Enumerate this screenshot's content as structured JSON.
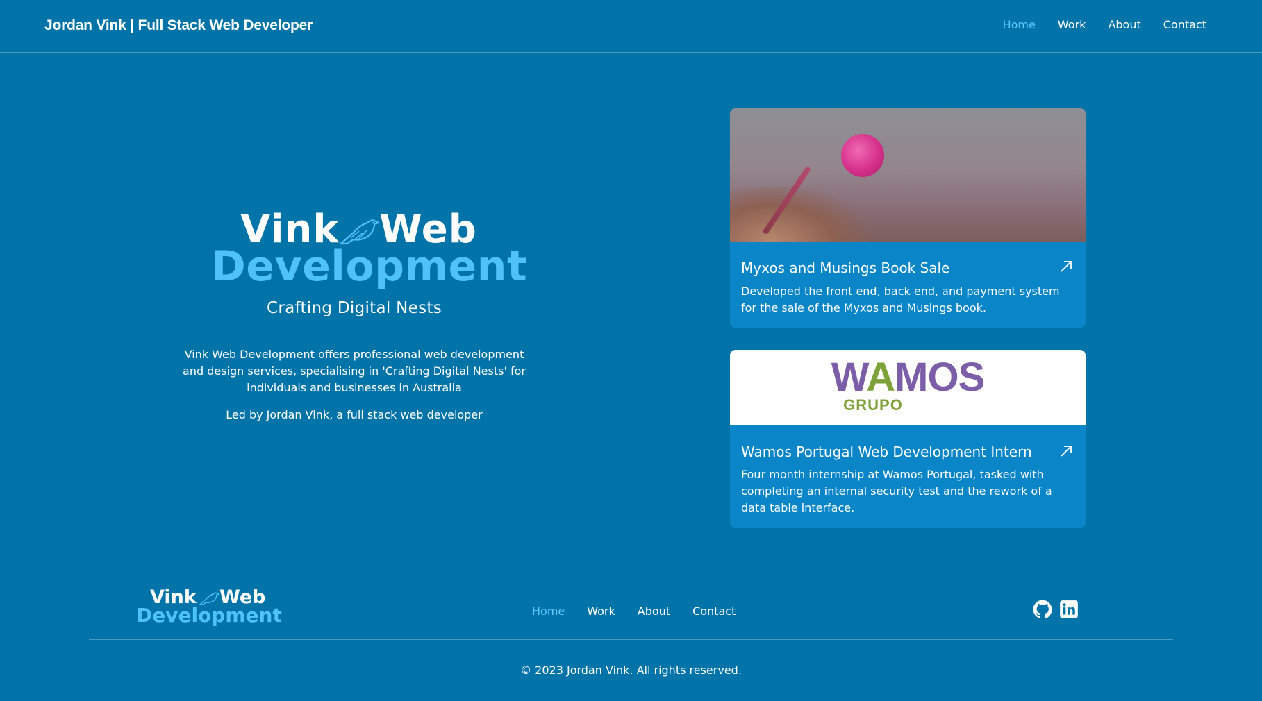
{
  "header": {
    "title": "Jordan Vink | Full Stack Web Developer",
    "nav": [
      {
        "label": "Home",
        "active": true
      },
      {
        "label": "Work",
        "active": false
      },
      {
        "label": "About",
        "active": false
      },
      {
        "label": "Contact",
        "active": false
      }
    ]
  },
  "hero": {
    "logo_word1": "Vink",
    "logo_word2": "Web",
    "logo_word3": "Development",
    "tagline": "Crafting Digital Nests",
    "description": "Vink Web Development offers professional web development and design services, specialising in 'Crafting Digital Nests' for individuals and businesses in Australia",
    "led_by": "Led by Jordan Vink, a full stack web developer"
  },
  "cards": [
    {
      "title": "Myxos and Musings Book Sale",
      "description": "Developed the front end, back end, and payment system for the sale of the Myxos and Musings book.",
      "image": "myxomycete-photo",
      "icon": "external-link-arrow-icon"
    },
    {
      "title": "Wamos Portugal Web Development Intern",
      "description": "Four month internship at Wamos Portugal, tasked with completing an internal security test and the rework of a data table interface.",
      "image": "wamos-grupo-logo",
      "logo_text": "WAMOS",
      "logo_subtext": "GRUPO",
      "icon": "external-link-arrow-icon"
    }
  ],
  "footer": {
    "logo_word1": "Vink",
    "logo_word2": "Web",
    "logo_word3": "Development",
    "nav": [
      {
        "label": "Home",
        "active": true
      },
      {
        "label": "Work",
        "active": false
      },
      {
        "label": "About",
        "active": false
      },
      {
        "label": "Contact",
        "active": false
      }
    ],
    "social": [
      "github-icon",
      "linkedin-icon"
    ],
    "copyright": "© 2023 Jordan Vink. All rights reserved."
  },
  "colors": {
    "background": "#0073a9",
    "card": "#0a86c8",
    "accent": "#5ec8ff",
    "logo_blue": "#4fc3f7",
    "wamos_purple": "#7b5ea7",
    "wamos_green": "#7ea13a"
  }
}
